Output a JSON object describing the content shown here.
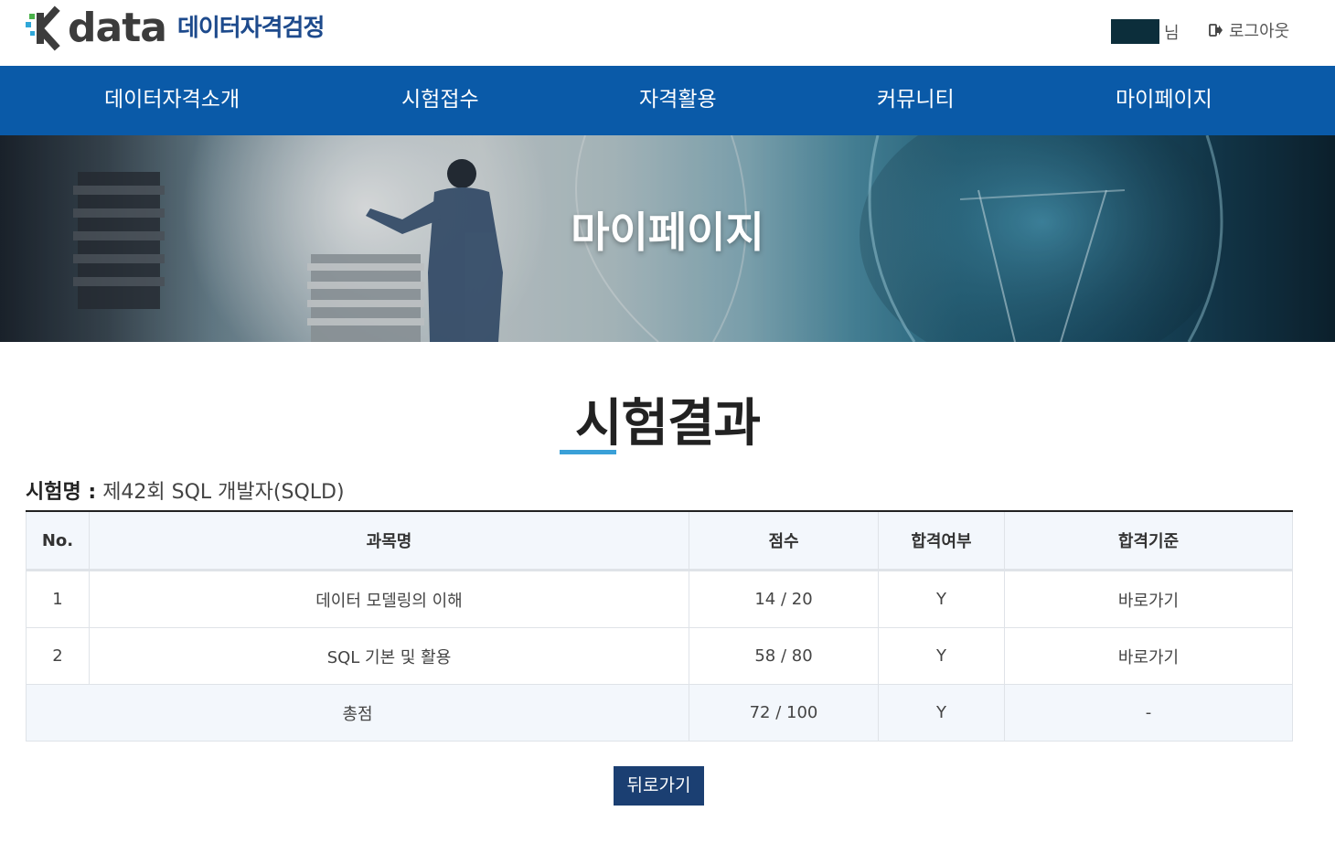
{
  "header": {
    "logo_text": "data",
    "logo_subtitle": "데이터자격검정",
    "user_suffix": "님",
    "logout_label": "로그아웃"
  },
  "nav": {
    "items": [
      "데이터자격소개",
      "시험접수",
      "자격활용",
      "커뮤니티",
      "마이페이지"
    ]
  },
  "banner": {
    "title": "마이페이지"
  },
  "section": {
    "title": "시험결과"
  },
  "exam": {
    "name_label": "시험명 :",
    "name_value": "제42회 SQL 개발자(SQLD)"
  },
  "table": {
    "headers": [
      "No.",
      "과목명",
      "점수",
      "합격여부",
      "합격기준"
    ],
    "rows": [
      {
        "no": "1",
        "subject": "데이터 모델링의 이해",
        "score": "14 / 20",
        "pass": "Y",
        "criteria": "바로가기"
      },
      {
        "no": "2",
        "subject": "SQL 기본 및 활용",
        "score": "58 / 80",
        "pass": "Y",
        "criteria": "바로가기"
      }
    ],
    "total": {
      "label": "총점",
      "score": "72 / 100",
      "pass": "Y",
      "criteria": "-"
    }
  },
  "back_button_label": "뒤로가기",
  "colors": {
    "nav_bg": "#0a5aa8",
    "back_button_bg": "#1b3f72",
    "title_accent": "#3aa0d8"
  }
}
